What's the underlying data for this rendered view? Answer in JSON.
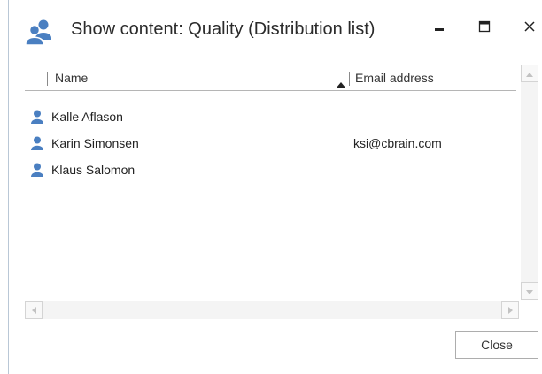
{
  "window": {
    "title": "Show content: Quality (Distribution list)",
    "icon": "group-icon",
    "accent_color": "#4a7fc1"
  },
  "columns": {
    "name": "Name",
    "email": "Email address",
    "sort_column": "Name",
    "sort_direction": "ascending"
  },
  "rows": [
    {
      "name": "Kalle Aflason",
      "email": ""
    },
    {
      "name": "Karin Simonsen",
      "email": "ksi@cbrain.com"
    },
    {
      "name": "Klaus Salomon",
      "email": ""
    }
  ],
  "buttons": {
    "close": "Close"
  }
}
